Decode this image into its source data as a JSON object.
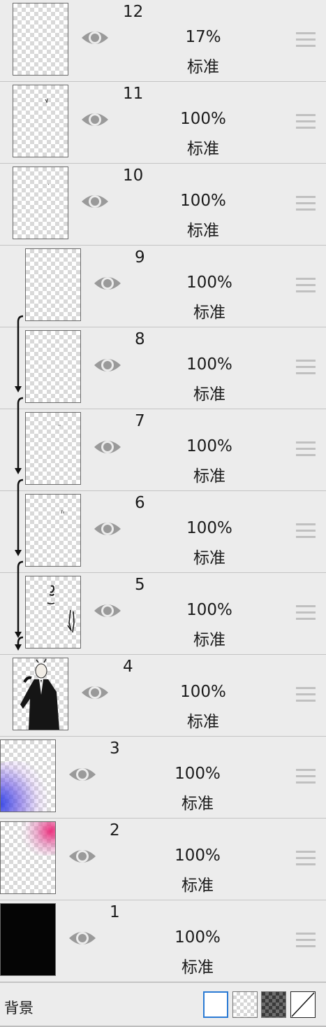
{
  "layers": [
    {
      "number": "12",
      "opacity": "17%",
      "blend_mode": "标准",
      "thumbnail": "transparent",
      "clipped": false
    },
    {
      "number": "11",
      "opacity": "100%",
      "blend_mode": "标准",
      "thumbnail": "transparent",
      "clipped": false
    },
    {
      "number": "10",
      "opacity": "100%",
      "blend_mode": "标准",
      "thumbnail": "transparent",
      "clipped": false
    },
    {
      "number": "9",
      "opacity": "100%",
      "blend_mode": "标准",
      "thumbnail": "transparent",
      "clipped": true
    },
    {
      "number": "8",
      "opacity": "100%",
      "blend_mode": "标准",
      "thumbnail": "transparent",
      "clipped": true
    },
    {
      "number": "7",
      "opacity": "100%",
      "blend_mode": "标准",
      "thumbnail": "transparent",
      "clipped": true
    },
    {
      "number": "6",
      "opacity": "100%",
      "blend_mode": "标准",
      "thumbnail": "transparent",
      "clipped": true
    },
    {
      "number": "5",
      "opacity": "100%",
      "blend_mode": "标准",
      "thumbnail": "lineart-strokes",
      "clipped": true
    },
    {
      "number": "4",
      "opacity": "100%",
      "blend_mode": "标准",
      "thumbnail": "character-in-suit",
      "clipped": false
    },
    {
      "number": "3",
      "opacity": "100%",
      "blend_mode": "标准",
      "thumbnail": "blue-purple-glow",
      "clipped": false
    },
    {
      "number": "2",
      "opacity": "100%",
      "blend_mode": "标准",
      "thumbnail": "pink-glow",
      "clipped": false
    },
    {
      "number": "1",
      "opacity": "100%",
      "blend_mode": "标准",
      "thumbnail": "solid-black",
      "clipped": false
    }
  ],
  "icons": {
    "visibility": "eye-icon",
    "reorder": "drag-handle-icon"
  },
  "background_bar": {
    "label": "背景",
    "options": [
      "white",
      "light-checker",
      "dark-checker",
      "none"
    ],
    "selected": "white"
  },
  "colors": {
    "panel": "#ececec",
    "eye": "#9a9a9a",
    "selected_border": "#2a7ad4"
  }
}
